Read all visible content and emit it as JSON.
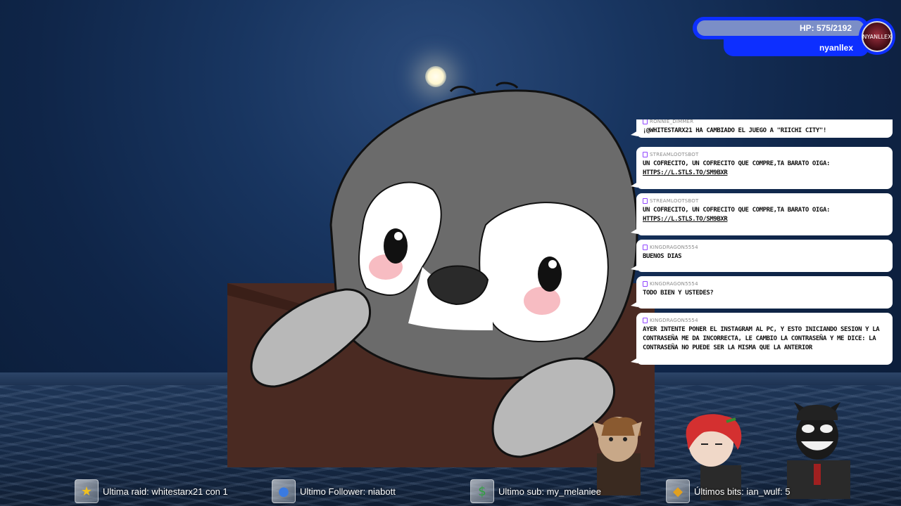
{
  "hp": {
    "text": "HP: 575/2192",
    "current": 575,
    "max": 2192,
    "username": "nyanllex",
    "avatar_label": "NYANLLEX"
  },
  "chat": [
    {
      "user": "ronnie_dimmer",
      "text": "¡@whitestarx21 ha cambiado el juego a \"Riichi City\"!",
      "link": ""
    },
    {
      "user": "streamlootsbot",
      "text": "un cofrecito, un cofrecito que compre,ta barato oiga:",
      "link": "https://l.stls.to/sm9bxr"
    },
    {
      "user": "streamlootsbot",
      "text": "un cofrecito, un cofrecito que compre,ta barato oiga:",
      "link": "https://l.stls.to/sm9bxr"
    },
    {
      "user": "kingdragon5554",
      "text": "buenos dias",
      "link": ""
    },
    {
      "user": "kingdragon5554",
      "text": "todo bien y ustedes?",
      "link": ""
    },
    {
      "user": "kingdragon5554",
      "text": "ayer intente poner el instagram al pc, y esto iniciando sesion y la contraseña me da incorrecta, le cambio la contraseña y me dice: la contraseña no puede ser la misma que la anterior",
      "link": ""
    }
  ],
  "bottom": {
    "raid": {
      "icon": "star-icon",
      "text": "Ultima raid: whitestarx21 con 1"
    },
    "follower": {
      "icon": "user-icon",
      "text": "Ultimo Follower: niabott"
    },
    "sub": {
      "icon": "money-bag-icon",
      "text": "Ultimo sub: my_melaniee"
    },
    "bits": {
      "icon": "gem-icon",
      "text": "Últimos bits: ian_wulf: 5"
    }
  },
  "colors": {
    "hp_blue": "#0d2fff",
    "twitch_purple": "#9146ff"
  }
}
